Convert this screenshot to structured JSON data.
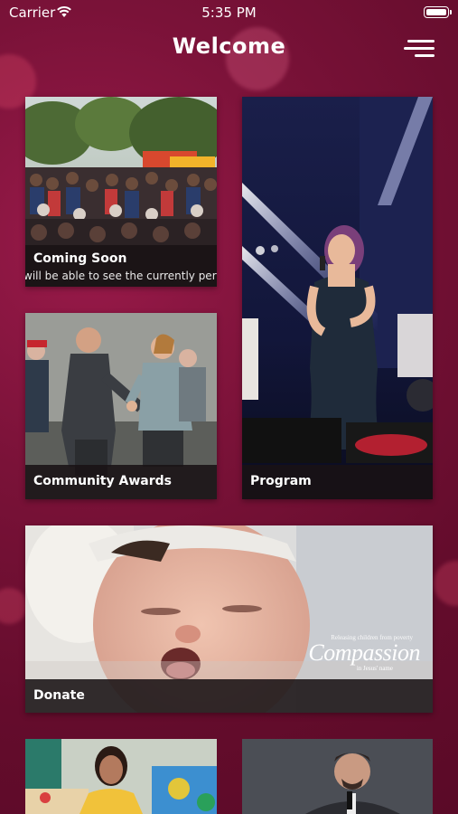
{
  "status_bar": {
    "carrier": "Carrier",
    "time": "5:35 PM"
  },
  "header": {
    "title": "Welcome"
  },
  "cards": {
    "coming_soon": {
      "title": "Coming Soon",
      "subtitle": "will be able to see the currently perf"
    },
    "community_awards": {
      "title": "Community Awards"
    },
    "program": {
      "title": "Program"
    },
    "donate": {
      "title": "Donate",
      "logo_text": "Compassion",
      "logo_tagline": "Releasing children from poverty",
      "logo_sub": "in Jesus' name"
    }
  },
  "colors": {
    "background": "#7a1238",
    "label_bar": "#191214"
  }
}
